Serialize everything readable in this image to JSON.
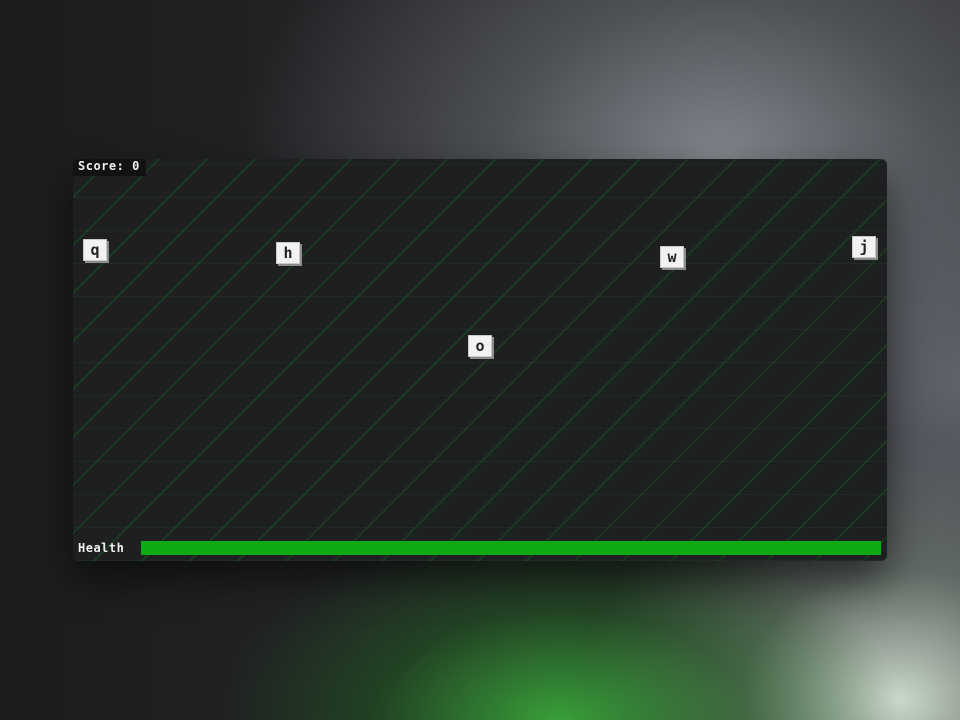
{
  "hud": {
    "score_text": "Score: 0",
    "health_label": "Health",
    "health_fraction": 1.0
  },
  "tiles": [
    {
      "id": "q",
      "letter": "q"
    },
    {
      "id": "h",
      "letter": "h"
    },
    {
      "id": "w",
      "letter": "w"
    },
    {
      "id": "j",
      "letter": "j"
    },
    {
      "id": "o",
      "letter": "o"
    }
  ],
  "colors": {
    "health_fill": "#0eaa16",
    "stripe": "#146e1e",
    "tile_face": "#f2f2f2"
  }
}
